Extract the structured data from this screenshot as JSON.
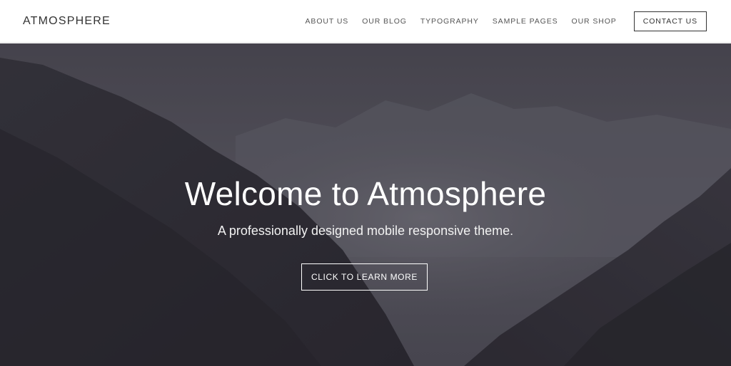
{
  "header": {
    "site_title": "ATMOSPHERE",
    "nav": [
      {
        "label": "ABOUT US"
      },
      {
        "label": "OUR BLOG"
      },
      {
        "label": "TYPOGRAPHY"
      },
      {
        "label": "SAMPLE PAGES"
      },
      {
        "label": "OUR SHOP"
      }
    ],
    "contact_label": "CONTACT US"
  },
  "hero": {
    "title": "Welcome to Atmosphere",
    "subtitle": "A professionally designed mobile responsive theme.",
    "button_label": "CLICK TO LEARN MORE",
    "background_image": "misty-mountain-valley",
    "overlay_color": "#3d3a45"
  }
}
